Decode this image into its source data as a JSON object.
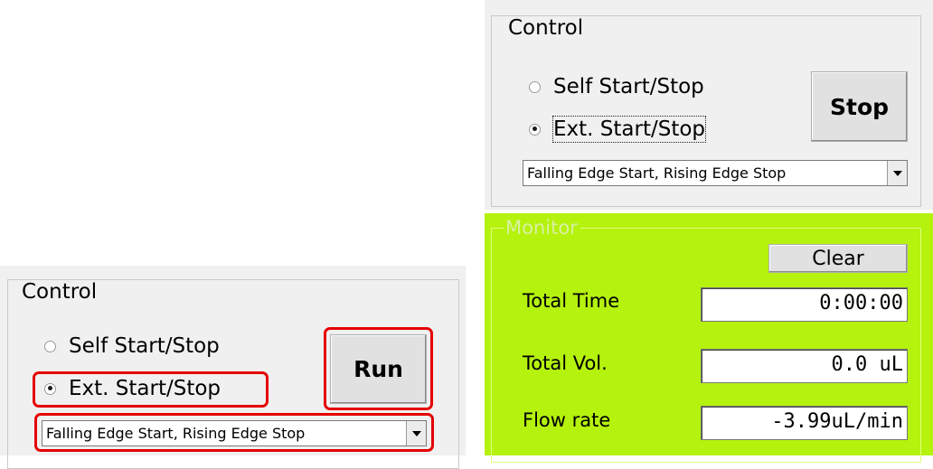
{
  "bottom_panel": {
    "legend": "Control",
    "radio_self": "Self Start/Stop",
    "radio_ext": "Ext. Start/Stop",
    "action_button": "Run",
    "trigger_select": "Falling Edge Start, Rising Edge Stop"
  },
  "top_panel": {
    "legend": "Control",
    "radio_self": "Self Start/Stop",
    "radio_ext": "Ext. Start/Stop",
    "action_button": "Stop",
    "trigger_select": "Falling Edge Start, Rising Edge Stop"
  },
  "monitor": {
    "legend": "Monitor",
    "clear_button": "Clear",
    "total_time_label": "Total Time",
    "total_time_value": "0:00:00",
    "total_vol_label": "Total Vol.",
    "total_vol_value": "0.0 uL",
    "flow_rate_label": "Flow rate",
    "flow_rate_value": "-3.99uL/min"
  },
  "colors": {
    "monitor_bg": "#b5f20e",
    "highlight": "#e50000"
  }
}
